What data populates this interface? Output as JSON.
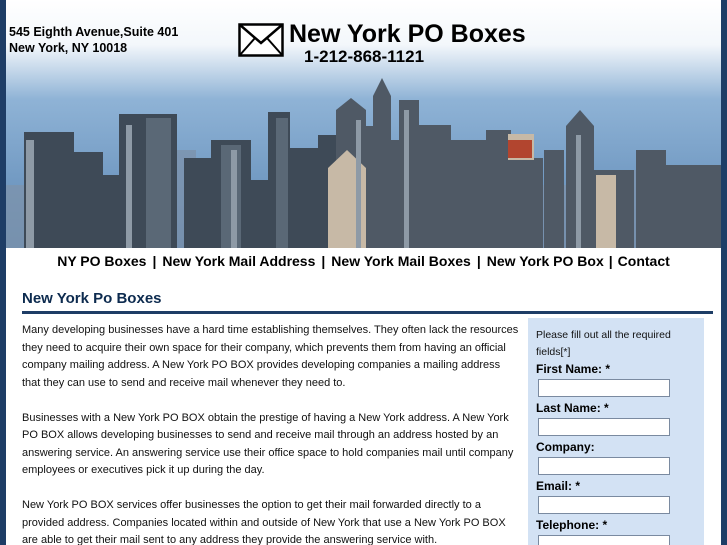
{
  "header": {
    "address_line1": "545 Eighth Avenue,Suite 401",
    "address_line2": "New York, NY 10018",
    "title": "New York PO Boxes",
    "phone": "1-212-868-1121"
  },
  "nav": {
    "items": [
      {
        "label": "NY PO Boxes"
      },
      {
        "label": "New York Mail Address"
      },
      {
        "label": "New York Mail Boxes"
      },
      {
        "label": "New York PO Box"
      },
      {
        "label": "Contact"
      }
    ],
    "separator": "|"
  },
  "main": {
    "heading": "New York Po Boxes",
    "paragraphs": [
      "Many developing businesses have a hard time establishing themselves. They often lack the resources they need to acquire their own space for their company, which prevents them from having an official company mailing address. A New York PO BOX provides developing companies a mailing address that they can use to send and receive mail whenever they need to.",
      "Businesses with a New York PO BOX obtain the prestige of having a New York address. A New York PO BOX  allows developing businesses to send and receive mail through an address hosted by an answering service. An answering service use their office space to hold companies mail until company employees or executives pick it up during the day.",
      "New York PO BOX services offer businesses the option to get their mail forwarded directly to a provided address.  Companies located within and outside of New York that use a New York PO BOX are able to get their mail sent to any address they provide the answering service with."
    ]
  },
  "form": {
    "note": "Please fill out all the required fields[*]",
    "fields": [
      {
        "label": "First Name:",
        "required": "*",
        "value": ""
      },
      {
        "label": "Last Name:",
        "required": "*",
        "value": ""
      },
      {
        "label": "Company:",
        "required": "",
        "value": ""
      },
      {
        "label": "Email:",
        "required": "*",
        "value": ""
      },
      {
        "label": "Telephone:",
        "required": "*",
        "value": ""
      }
    ]
  },
  "colors": {
    "page_background": "#1e3d66",
    "heading": "#0d2b4f",
    "form_panel": "#d3e2f4"
  },
  "icons": {
    "brand": "envelope-icon"
  }
}
